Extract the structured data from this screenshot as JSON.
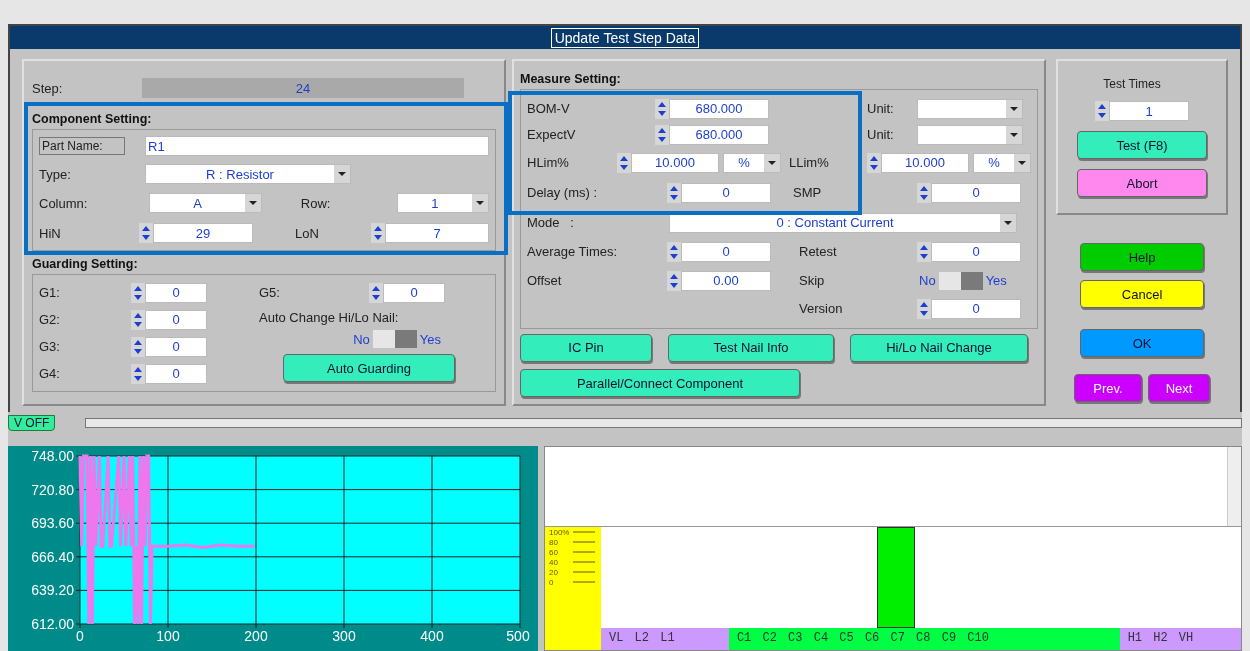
{
  "dialog": {
    "title": "Update Test Step Data"
  },
  "step": {
    "label": "Step:",
    "value": "24"
  },
  "component_setting": {
    "title": "Component Setting:",
    "part_name": {
      "label": "Part Name:",
      "value": "R1"
    },
    "type": {
      "label": "Type:",
      "value": "R : Resistor"
    },
    "column": {
      "label": "Column:",
      "value": "A"
    },
    "row": {
      "label": "Row:",
      "value": "1"
    },
    "hin": {
      "label": "HiN",
      "value": "29"
    },
    "lon": {
      "label": "LoN",
      "value": "7"
    }
  },
  "guarding_setting": {
    "title": "Guarding Setting:",
    "fields": [
      {
        "label": "G1:",
        "value": "0"
      },
      {
        "label": "G2:",
        "value": "0"
      },
      {
        "label": "G3:",
        "value": "0"
      },
      {
        "label": "G4:",
        "value": "0"
      }
    ],
    "g5": {
      "label": "G5:",
      "value": "0"
    },
    "auto_change": {
      "label": "Auto Change Hi/Lo Nail:",
      "off_label": "No",
      "on_label": "Yes",
      "on": true
    },
    "auto_guarding_button": "Auto Guarding"
  },
  "measure_setting": {
    "title": "Measure Setting:",
    "bom_v": {
      "label": "BOM-V",
      "value": "680.000",
      "unit_label": "Unit:"
    },
    "expect_v": {
      "label": "ExpectV",
      "value": "680.000",
      "unit_label": "Unit:"
    },
    "hlim": {
      "label": "HLim%",
      "value": "10.000",
      "unit": "%"
    },
    "llim": {
      "label": "LLim%",
      "value": "10.000",
      "unit": "%"
    },
    "delay": {
      "label": "Delay (ms) :",
      "value": "0"
    },
    "smp": {
      "label": "SMP",
      "value": "0"
    },
    "mode": {
      "label": "Mode   :",
      "value": "0 : Constant Current"
    },
    "average_times": {
      "label": "Average Times:",
      "value": "0"
    },
    "retest": {
      "label": "Retest",
      "value": "0"
    },
    "offset": {
      "label": "Offset",
      "value": "0.00"
    },
    "skip": {
      "label": "Skip",
      "off_label": "No",
      "on_label": "Yes",
      "on": true
    },
    "version": {
      "label": "Version",
      "value": "0"
    },
    "buttons": [
      "IC Pin",
      "Test Nail Info",
      "Hi/Lo Nail Change"
    ],
    "wide_button": "Parallel/Connect Component"
  },
  "test_panel": {
    "label": "Test Times",
    "value": "1",
    "test_button": "Test (F8)",
    "abort_button": "Abort"
  },
  "actions": [
    {
      "label": "Help",
      "color": "#00cc00"
    },
    {
      "label": "Cancel",
      "color": "#ffff00"
    },
    {
      "label": "OK",
      "color": "#0099ff"
    }
  ],
  "nav": [
    {
      "label": "Prev.",
      "color": "#cc00ff"
    },
    {
      "label": "Next",
      "color": "#cc00ff"
    }
  ],
  "status_tab": "V OFF",
  "voltage_chart": {
    "chart_data": {
      "type": "line",
      "x": [
        0,
        2,
        4,
        8,
        10,
        12,
        14,
        16,
        18,
        22,
        24,
        26,
        32,
        34,
        36,
        44,
        46,
        50,
        52,
        56,
        58,
        60,
        62,
        64,
        66,
        68,
        70,
        72,
        74,
        76,
        78,
        80,
        82,
        100,
        120,
        140,
        160,
        180,
        198
      ],
      "grid": true,
      "series": [
        {
          "color": "#ee77ee",
          "values": [
            748,
            675,
            748,
            748,
            612,
            748,
            612,
            748,
            675,
            748,
            675,
            675,
            748,
            675,
            675,
            748,
            675,
            748,
            675,
            748,
            675,
            748,
            612,
            675,
            612,
            748,
            612,
            748,
            675,
            748,
            748,
            612,
            675,
            675,
            676,
            674,
            676,
            675,
            675
          ]
        }
      ],
      "xlim": [
        0,
        500
      ],
      "ylim": [
        612,
        748
      ],
      "xticks": [
        0,
        100,
        200,
        300,
        400,
        500
      ],
      "yticks": [
        {
          "value": 748,
          "label": "748.00"
        },
        {
          "value": 720.8,
          "label": "720.80"
        },
        {
          "value": 693.6,
          "label": "693.60"
        },
        {
          "value": 666.4,
          "label": "666.40"
        },
        {
          "value": 639.2,
          "label": "639.20"
        },
        {
          "value": 612,
          "label": "612.00"
        }
      ]
    }
  },
  "gauge": {
    "scale": [
      "100%",
      "80",
      "60",
      "40",
      "20",
      "0"
    ],
    "groups": [
      {
        "label": "VL L2 L1",
        "color": "#cc99ff"
      },
      {
        "label": "C1 C2 C3 C4 C5 C6 C7 C8 C9 C10",
        "color": "#00ff44"
      },
      {
        "label": "H1 H2 VH",
        "color": "#cc99ff"
      }
    ]
  }
}
